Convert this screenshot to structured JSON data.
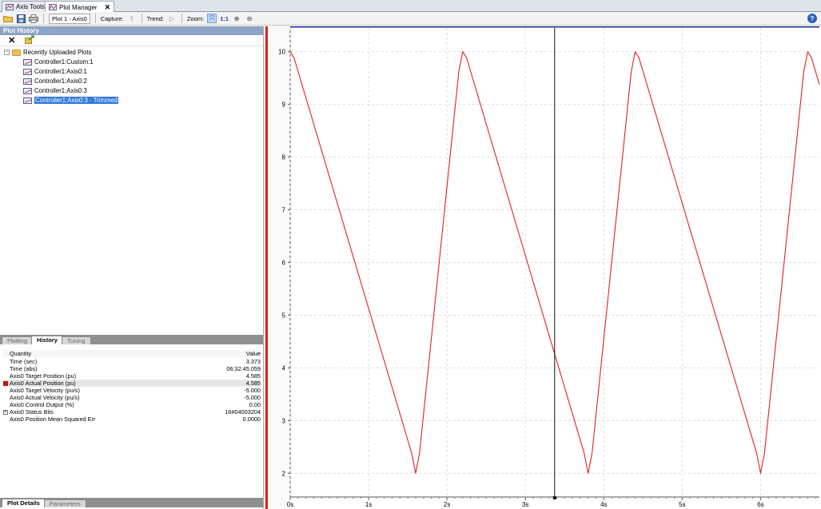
{
  "tabs": [
    {
      "label": "Axis Tools",
      "active": false
    },
    {
      "label": "Plot Manager",
      "active": true
    }
  ],
  "toolbar": {
    "plot_select": "Plot 1 - Axis0",
    "capture_label": "Capture:",
    "trend_label": "Trend:",
    "zoom_label": "Zoom:",
    "zoom_one_to_one": "1:1"
  },
  "plot_history": {
    "title": "Plot History",
    "folder": "Recently Uploaded Plots",
    "items": [
      {
        "label": "Controller1:Custom:1",
        "selected": false
      },
      {
        "label": "Controller1:Axis0:1",
        "selected": false
      },
      {
        "label": "Controller1:Axis0:2",
        "selected": false
      },
      {
        "label": "Controller1:Axis0:3",
        "selected": false
      },
      {
        "label": "Controller1:Axis0:3 - Trimmed",
        "selected": true
      }
    ]
  },
  "upper_tabs": [
    "Plotting",
    "History",
    "Tuning"
  ],
  "upper_active_tab": "History",
  "details": {
    "header_quantity": "Quantity",
    "header_value": "Value",
    "rows": [
      {
        "q": "Time (sec)",
        "v": "3.373",
        "marker": "none"
      },
      {
        "q": "Time (abs)",
        "v": "06:32:45.059",
        "marker": "none"
      },
      {
        "q": "Axis0 Target Position (pu)",
        "v": "4.585",
        "marker": "blank"
      },
      {
        "q": "Axis0 Actual Position (pu)",
        "v": "4.585",
        "marker": "red"
      },
      {
        "q": "Axis0 Target Velocity (pu/s)",
        "v": "-5.000",
        "marker": "blank"
      },
      {
        "q": "Axis0 Actual Velocity (pu/s)",
        "v": "-5.000",
        "marker": "blank"
      },
      {
        "q": "Axis0 Control Output (%)",
        "v": "0.00",
        "marker": "blank"
      },
      {
        "q": "Axis0 Status Bits",
        "v": "16#04003204",
        "marker": "plus"
      },
      {
        "q": "Axis0 Position Mean Squared Err",
        "v": "0.0000",
        "marker": "none"
      }
    ]
  },
  "lower_tabs": [
    "Plot Details",
    "Parameters"
  ],
  "lower_active_tab": "Plot Details",
  "colors": {
    "series": "#e02020",
    "panel_header": "#8ba3c4",
    "selection": "#3079d6"
  },
  "chart_data": {
    "type": "line",
    "x_tick_labels": [
      "0s",
      "1s",
      "2s",
      "3s",
      "4s",
      "5s",
      "6s"
    ],
    "y_tick_labels": [
      "2",
      "3",
      "4",
      "5",
      "6",
      "7",
      "8",
      "9",
      "10"
    ],
    "xlim": [
      0,
      6.75
    ],
    "ylim": [
      1.55,
      10.45
    ],
    "cursor_x": 3.373,
    "grid": true,
    "series": [
      {
        "x": [
          0,
          0.05,
          1.55,
          1.6,
          1.65,
          2.15,
          2.2,
          2.25,
          3.75,
          3.8,
          3.85,
          4.35,
          4.4,
          4.45,
          5.95,
          6.0,
          6.05,
          6.55,
          6.6,
          6.65,
          6.75
        ],
        "y": [
          10,
          9.88,
          2.38,
          2.0,
          2.38,
          9.62,
          10,
          9.88,
          2.38,
          2.0,
          2.38,
          9.62,
          10,
          9.88,
          2.38,
          2.0,
          2.38,
          9.62,
          10,
          9.88,
          9.38
        ]
      }
    ]
  }
}
